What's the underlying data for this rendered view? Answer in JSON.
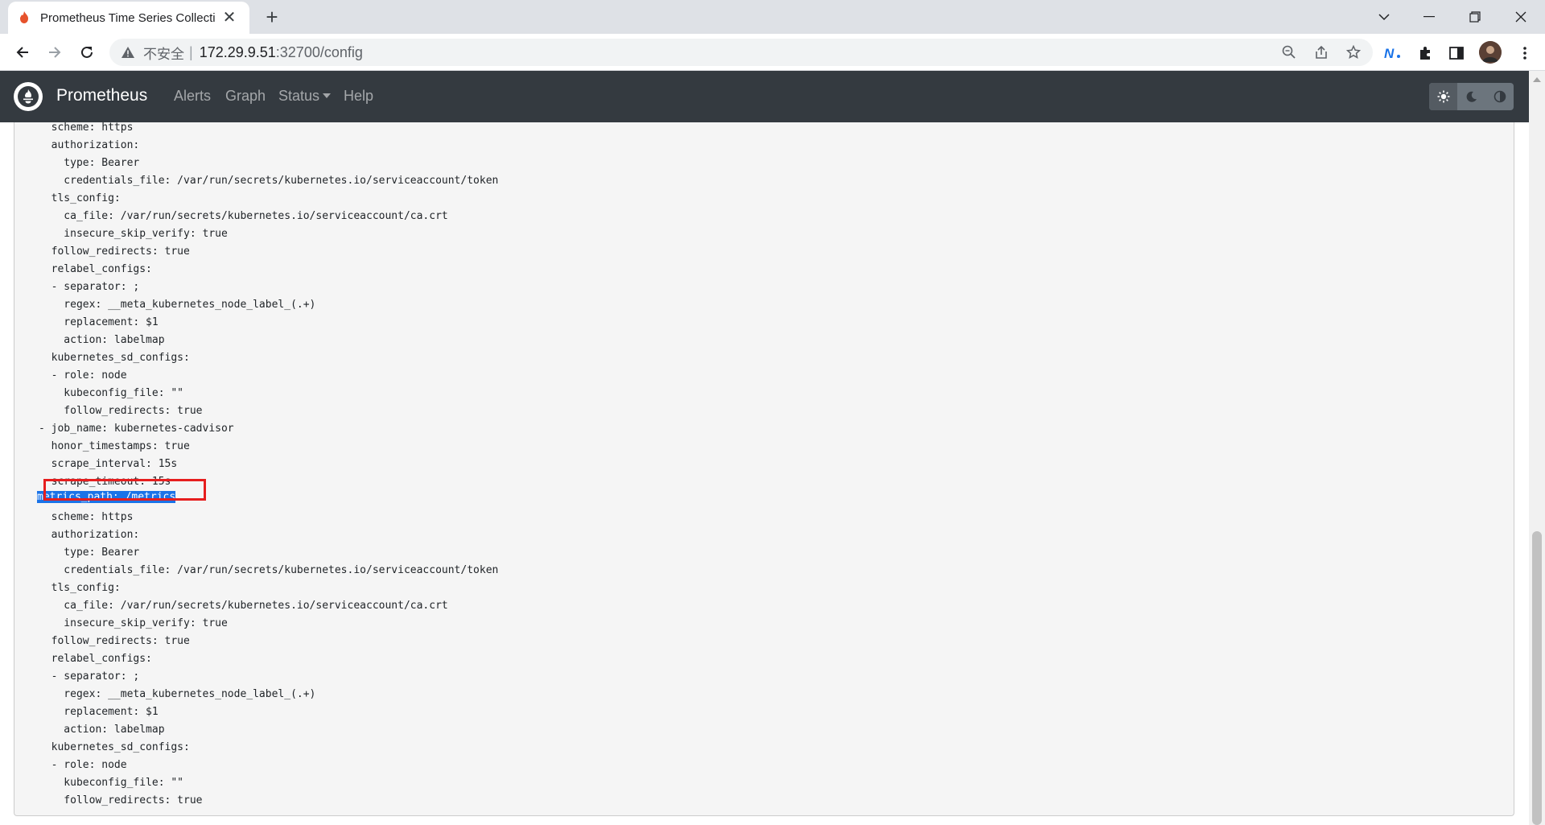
{
  "browser": {
    "tab_title": "Prometheus Time Series Collection and Processing Server",
    "new_tab": "+",
    "close": "✕",
    "omnibox": {
      "insecure_label": "不安全",
      "separator": "|",
      "host": "172.29.9.51",
      "path": ":32700/config"
    }
  },
  "navbar": {
    "brand": "Prometheus",
    "links": [
      "Alerts",
      "Graph",
      "Status",
      "Help"
    ]
  },
  "config_lines": [
    "  scheme: https",
    "  authorization:",
    "    type: Bearer",
    "    credentials_file: /var/run/secrets/kubernetes.io/serviceaccount/token",
    "  tls_config:",
    "    ca_file: /var/run/secrets/kubernetes.io/serviceaccount/ca.crt",
    "    insecure_skip_verify: true",
    "  follow_redirects: true",
    "  relabel_configs:",
    "  - separator: ;",
    "    regex: __meta_kubernetes_node_label_(.+)",
    "    replacement: $1",
    "    action: labelmap",
    "  kubernetes_sd_configs:",
    "  - role: node",
    "    kubeconfig_file: \"\"",
    "    follow_redirects: true",
    "- job_name: kubernetes-cadvisor",
    "  honor_timestamps: true",
    "  scrape_interval: 15s",
    "  scrape_timeout: 15s",
    "  ",
    "  scheme: https",
    "  authorization:",
    "    type: Bearer",
    "    credentials_file: /var/run/secrets/kubernetes.io/serviceaccount/token",
    "  tls_config:",
    "    ca_file: /var/run/secrets/kubernetes.io/serviceaccount/ca.crt",
    "    insecure_skip_verify: true",
    "  follow_redirects: true",
    "  relabel_configs:",
    "  - separator: ;",
    "    regex: __meta_kubernetes_node_label_(.+)",
    "    replacement: $1",
    "    action: labelmap",
    "  kubernetes_sd_configs:",
    "  - role: node",
    "    kubeconfig_file: \"\"",
    "    follow_redirects: true"
  ],
  "selected_line": "metrics_path: /metrics",
  "colors": {
    "navbar_bg": "#343a40",
    "selection": "#1a73e8",
    "highlight_border": "#e61e1e"
  }
}
